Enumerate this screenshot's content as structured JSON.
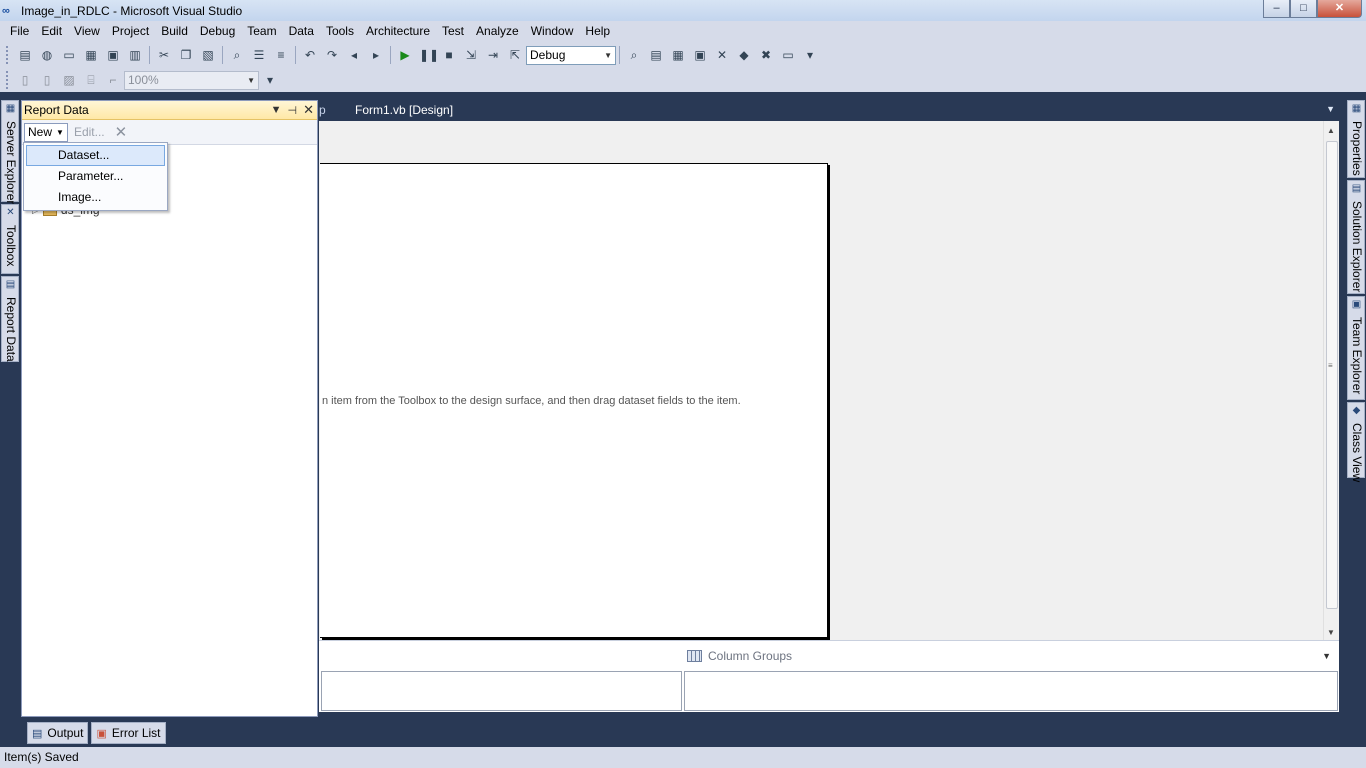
{
  "window": {
    "title": "Image_in_RDLC - Microsoft Visual Studio",
    "minimize": "–",
    "maximize": "□",
    "close": "✕"
  },
  "menu": [
    "File",
    "Edit",
    "View",
    "Project",
    "Build",
    "Debug",
    "Team",
    "Data",
    "Tools",
    "Architecture",
    "Test",
    "Analyze",
    "Window",
    "Help"
  ],
  "toolbar": {
    "config_value": "Debug",
    "zoom_value": "100%"
  },
  "left_tabs": [
    "Server Explorer",
    "Toolbox",
    "Report Data"
  ],
  "right_tabs": [
    "Properties",
    "Solution Explorer",
    "Team Explorer",
    "Class View"
  ],
  "report_data_panel": {
    "title": "Report Data",
    "new_label": "New",
    "edit_label": "Edit...",
    "tree_node": "ds_img",
    "new_menu": [
      "Dataset...",
      "Parameter...",
      "Image..."
    ]
  },
  "document": {
    "partial_tab": "p",
    "tab_label": "Form1.vb [Design]",
    "hint_text": "n item from the Toolbox to the design surface, and then drag dataset fields to the item."
  },
  "groups": {
    "column_groups_label": "Column Groups"
  },
  "bottom_tabs": [
    "Output",
    "Error List"
  ],
  "status": {
    "text": "Item(s) Saved"
  },
  "colors": {
    "chrome": "#293955",
    "toolbar": "#d6dbe9",
    "panel_header": "#ffe8a6",
    "selection": "#dce9fb"
  }
}
